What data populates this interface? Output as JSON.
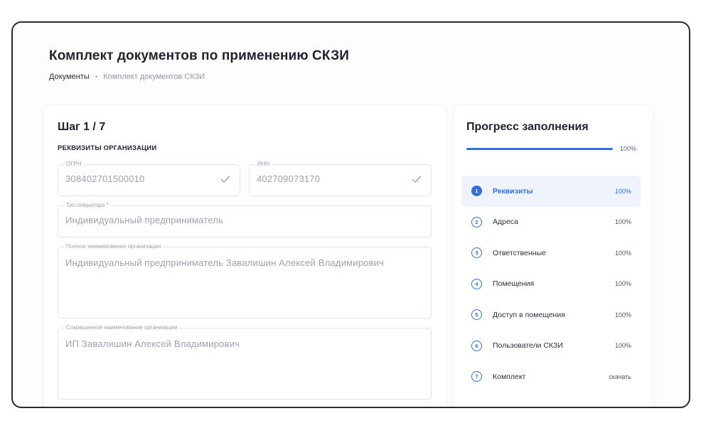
{
  "header": {
    "title": "Комплект документов по применению СКЗИ",
    "breadcrumb": {
      "root": "Документы",
      "separator": "•",
      "current": "Комплект документов СКЗИ"
    }
  },
  "form": {
    "step_title": "Шаг 1 / 7",
    "section_title": "РЕКВИЗИТЫ ОРГАНИЗАЦИИ",
    "fields": {
      "ogrn": {
        "label": "ОГРН",
        "value": "308402701500010"
      },
      "inn": {
        "label": "ИНН",
        "value": "402709073170"
      },
      "operator_type": {
        "label": "Тип оператора *",
        "value": "Индивидуальный предприниматель"
      },
      "full_name": {
        "label": "Полное наименование организации",
        "value": "Индивидуальный предприниматель Завалишин Алексей Владимирович"
      },
      "short_name": {
        "label": "Сокращенное наименование организации",
        "value": "ИП Завалишин Алексей Владимирович"
      }
    }
  },
  "progress": {
    "title": "Прогресс заполнения",
    "overall": 100,
    "overall_label": "100%",
    "steps": [
      {
        "num": "1",
        "name": "Реквизиты",
        "value": "100%",
        "active": true
      },
      {
        "num": "2",
        "name": "Адреса",
        "value": "100%",
        "active": false
      },
      {
        "num": "3",
        "name": "Ответственные",
        "value": "100%",
        "active": false
      },
      {
        "num": "4",
        "name": "Помещения",
        "value": "100%",
        "active": false
      },
      {
        "num": "5",
        "name": "Доступ в помещения",
        "value": "100%",
        "active": false
      },
      {
        "num": "6",
        "name": "Пользователи СКЗИ",
        "value": "100%",
        "active": false
      },
      {
        "num": "7",
        "name": "Комплект",
        "value": "скачать",
        "active": false
      }
    ]
  },
  "colors": {
    "accent": "#2f6fd6",
    "active_bg": "#eef3fc",
    "border": "#dfe3ea"
  },
  "icons": {
    "valid": "check-icon"
  }
}
